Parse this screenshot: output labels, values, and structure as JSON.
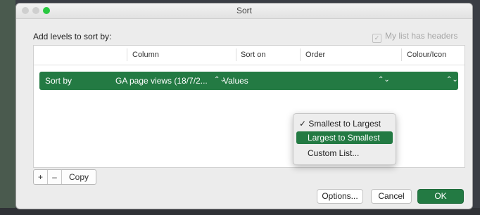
{
  "window": {
    "title": "Sort"
  },
  "dialog": {
    "add_levels_label": "Add levels to sort by:",
    "headers_checkbox": {
      "label": "My list has headers",
      "checked": true,
      "enabled": false
    }
  },
  "table": {
    "headers": {
      "column": "Column",
      "sort_on": "Sort on",
      "order": "Order",
      "colour_icon": "Colour/Icon"
    },
    "rows": [
      {
        "label": "Sort by",
        "column": "GA page views (18/7/2...",
        "sort_on": "Values",
        "order": "Largest to Smallest",
        "colour_icon": ""
      }
    ]
  },
  "order_menu": {
    "items": [
      {
        "label": "✓ Smallest to Largest",
        "checked": true,
        "highlighted": false
      },
      {
        "label": "Largest to Smallest",
        "checked": false,
        "highlighted": true
      },
      {
        "label": "Custom List...",
        "checked": false,
        "highlighted": false
      }
    ]
  },
  "level_controls": {
    "add": "+",
    "remove": "–",
    "copy": "Copy"
  },
  "buttons": {
    "options": "Options...",
    "cancel": "Cancel",
    "ok": "OK"
  },
  "colors": {
    "accent": "#237a43",
    "window_bg": "#ececec"
  }
}
